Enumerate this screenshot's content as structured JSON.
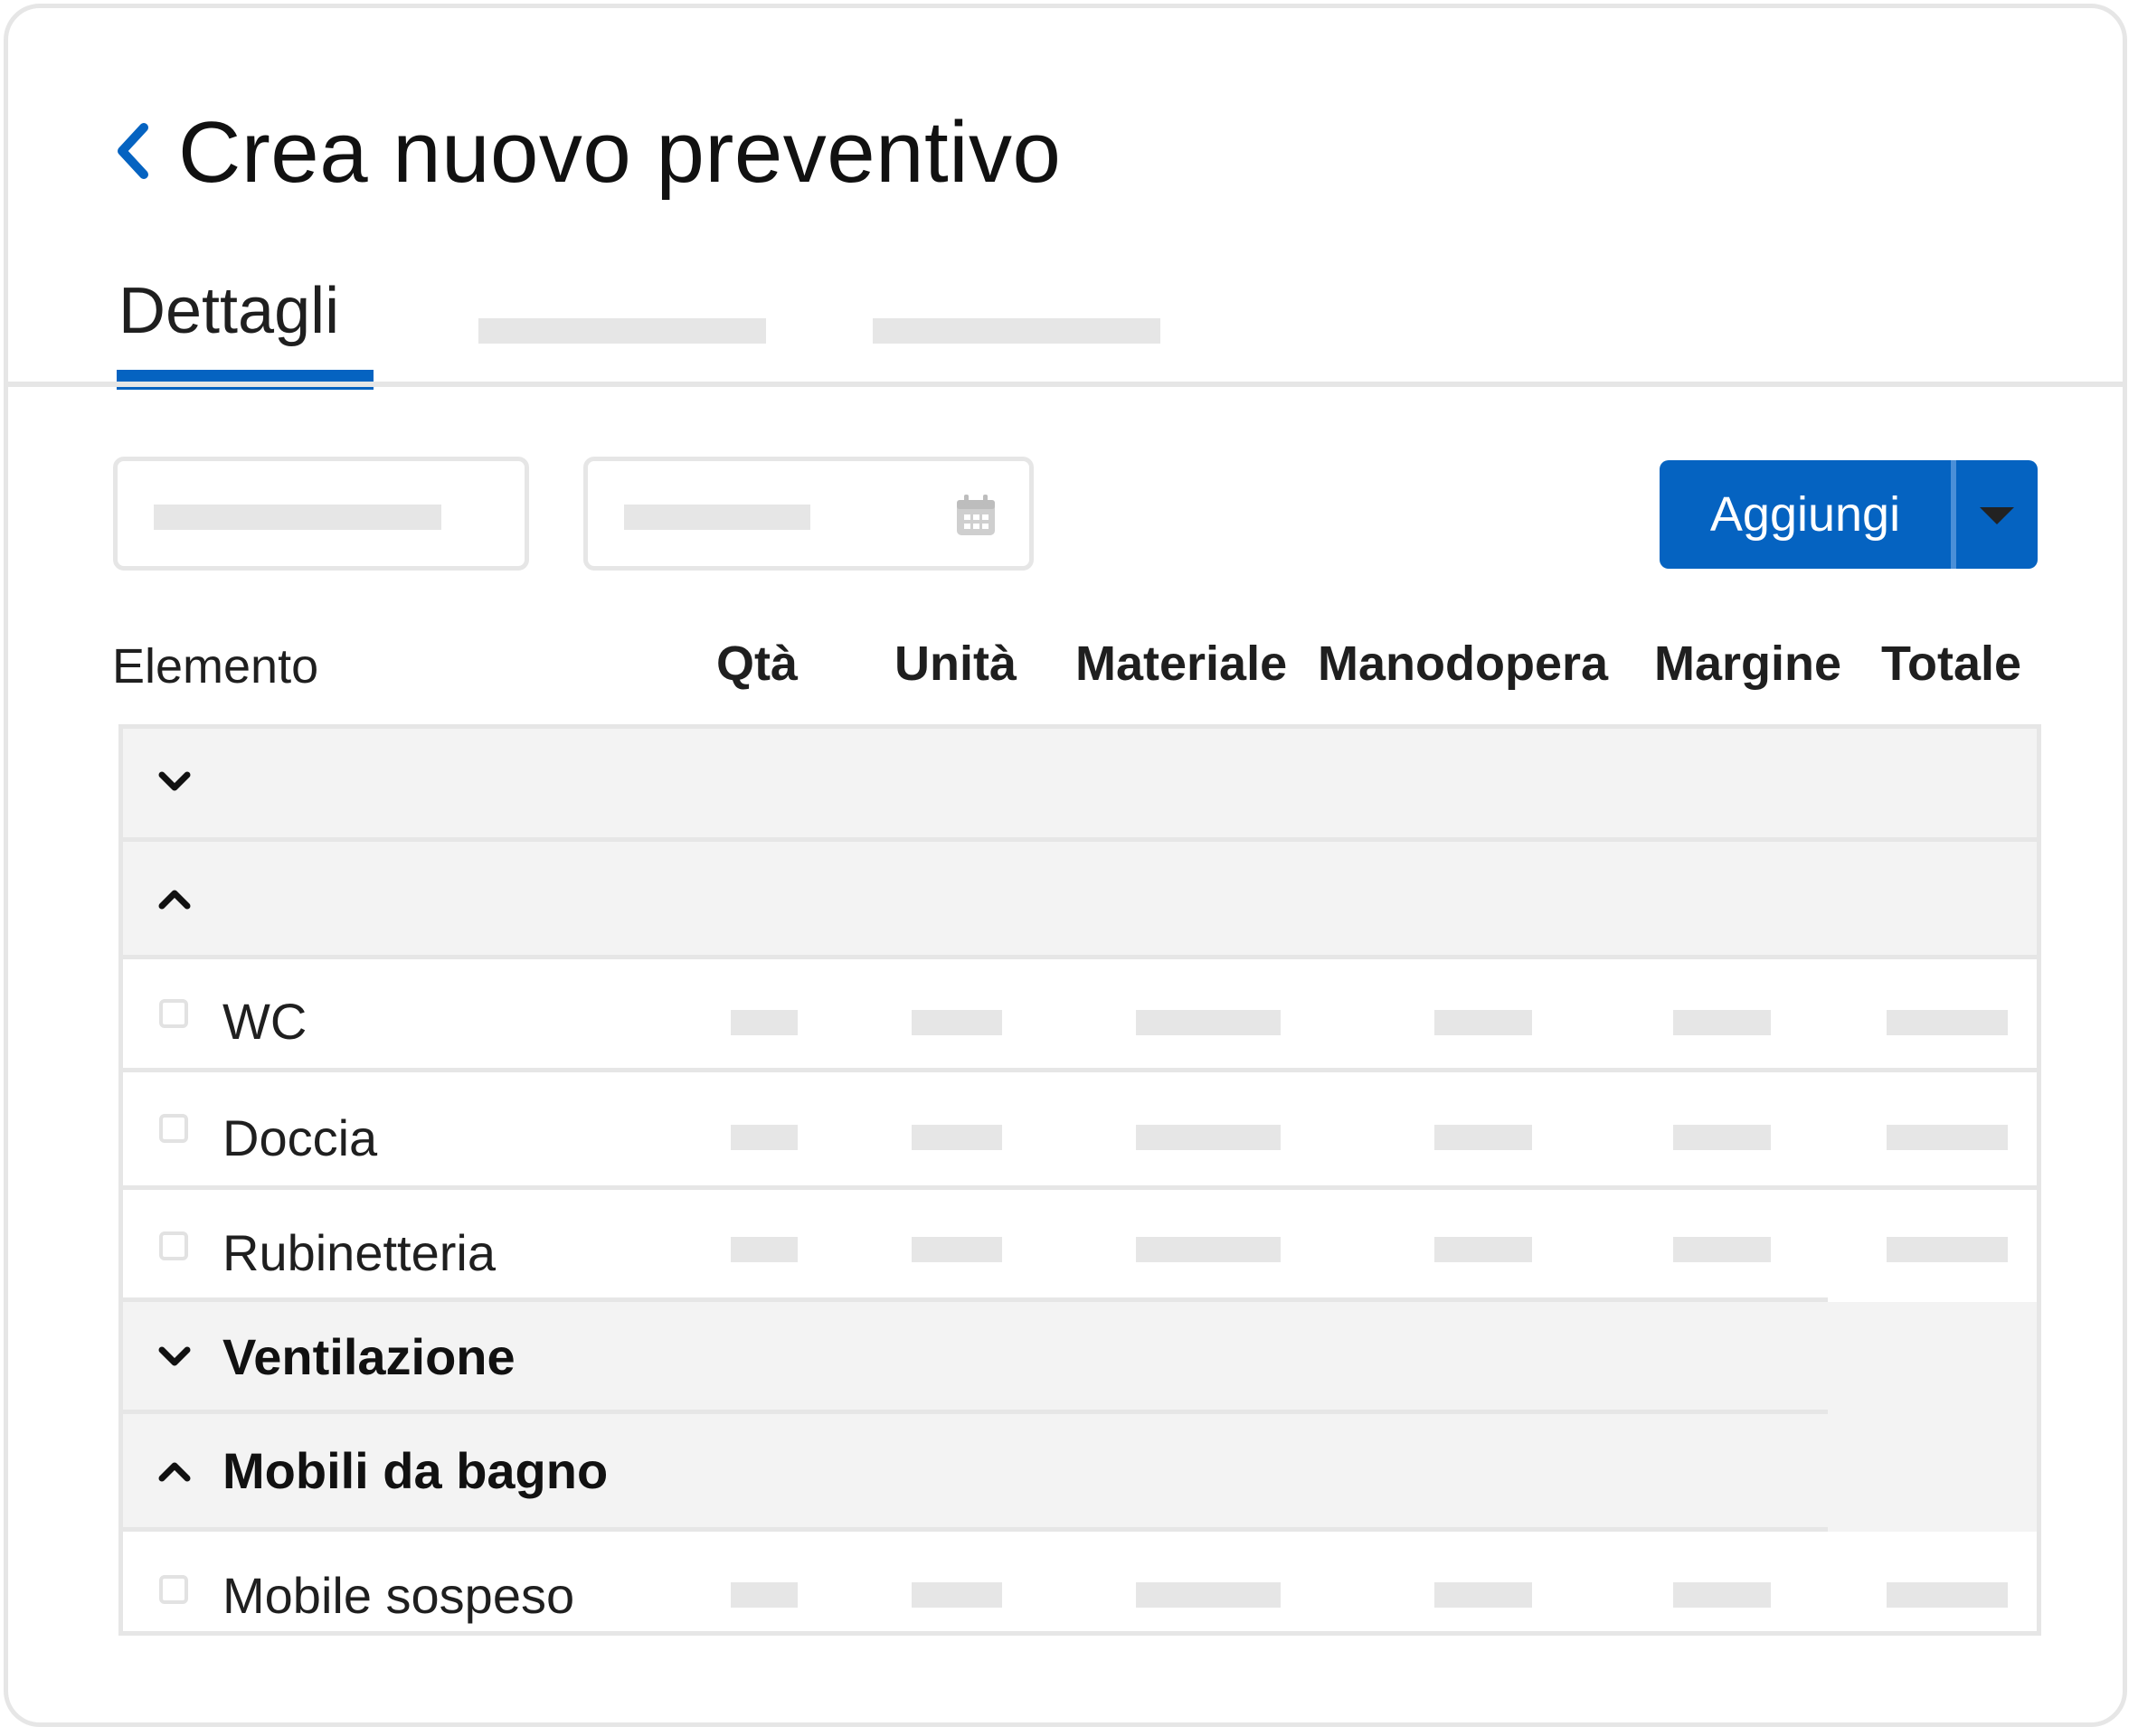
{
  "header": {
    "back_icon": "chevron-left-icon",
    "title": "Crea nuovo preventivo"
  },
  "tabs": [
    {
      "label": "Dettagli",
      "active": true
    }
  ],
  "toolbar": {
    "date_icon": "calendar-icon",
    "add_button_label": "Aggiungi",
    "add_menu_icon": "caret-down-icon"
  },
  "table": {
    "columns": [
      "Elemento",
      "Qtà",
      "Unità",
      "Materiale",
      "Manodopera",
      "Margine",
      "Totale"
    ],
    "rows": [
      {
        "type": "group",
        "label": "",
        "expanded": false
      },
      {
        "type": "group",
        "label": "",
        "expanded": true
      },
      {
        "type": "item",
        "label": "WC",
        "checked": false
      },
      {
        "type": "item",
        "label": "Doccia",
        "checked": false
      },
      {
        "type": "item",
        "label": "Rubinetteria",
        "checked": false
      },
      {
        "type": "group",
        "label": "Ventilazione",
        "expanded": false
      },
      {
        "type": "group",
        "label": "Mobili da bagno",
        "expanded": true
      },
      {
        "type": "item",
        "label": "Mobile sospeso",
        "checked": false
      }
    ]
  },
  "colors": {
    "accent": "#0563c1",
    "placeholder": "#e6e6e6",
    "group_row_bg": "#f3f3f3",
    "border": "#e6e6e6"
  }
}
